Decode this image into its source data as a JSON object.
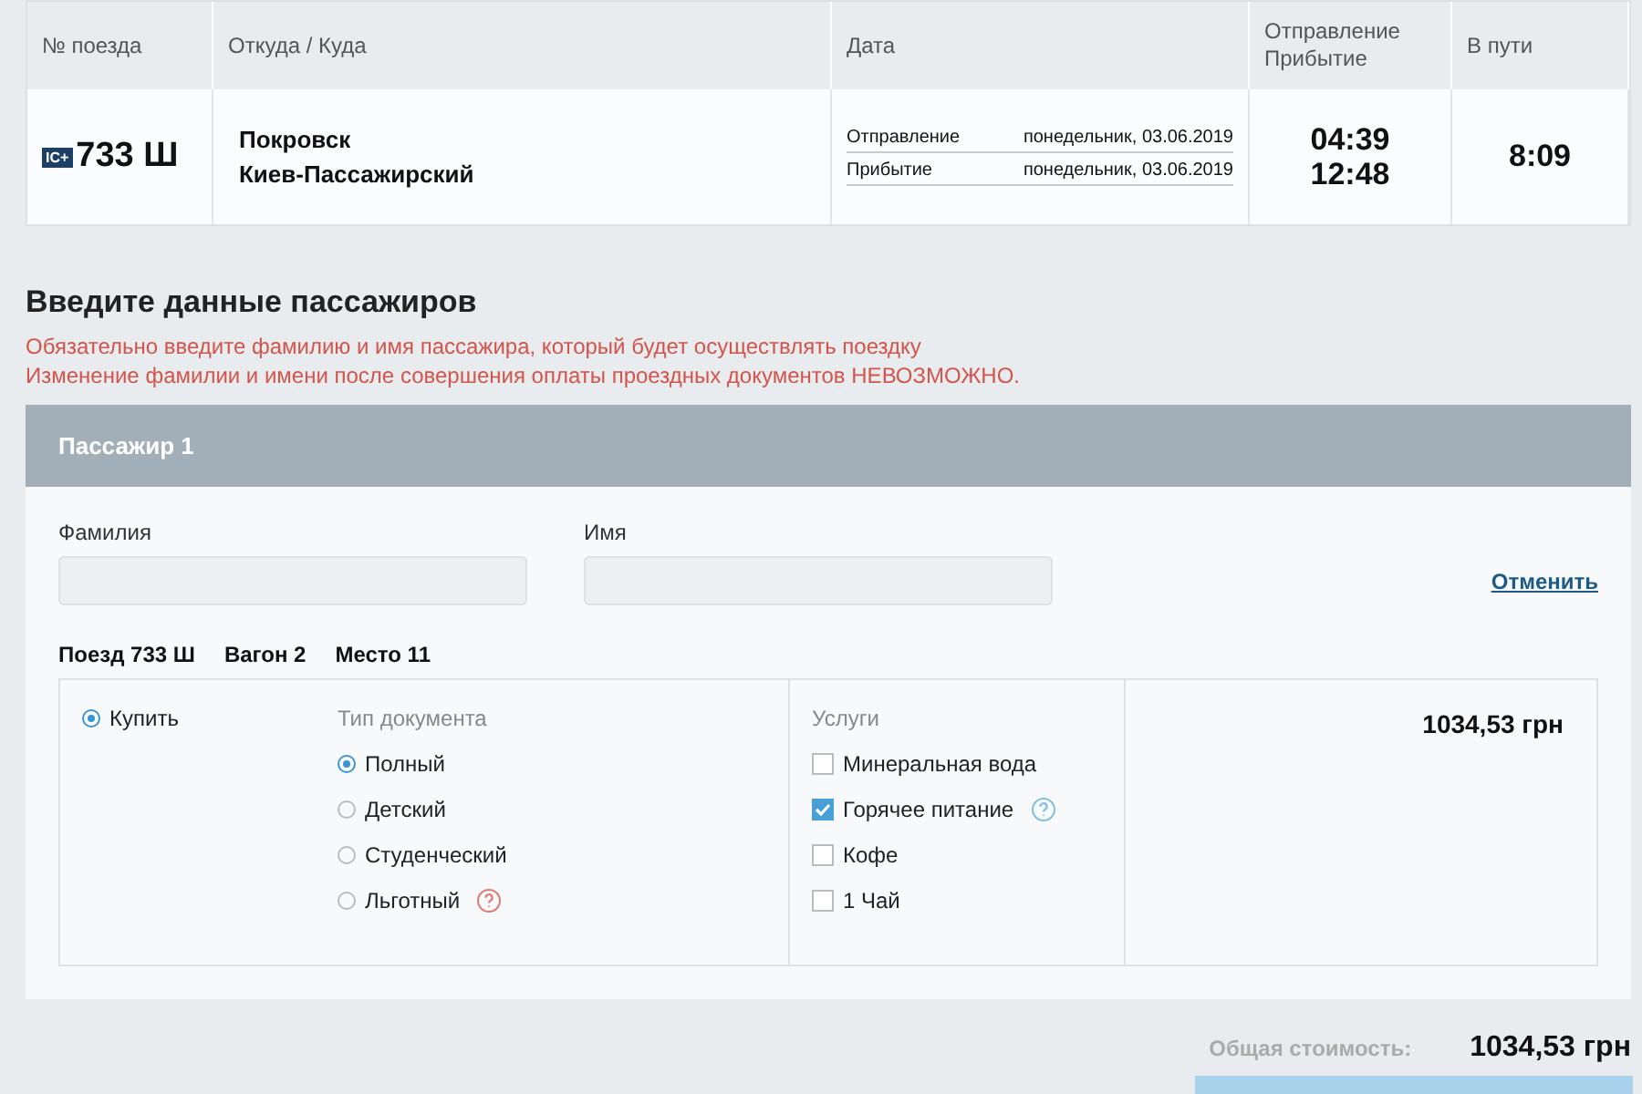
{
  "trip_table": {
    "columns": [
      "№ поезда",
      "Откуда / Куда",
      "Дата",
      "Отправление Прибытие",
      "В пути"
    ],
    "row": {
      "train_badge": "IC+",
      "train": "733 Ш",
      "from": "Покровск",
      "to": "Киев-Пассажирский",
      "dates": [
        {
          "label": "Отправление",
          "value": "понедельник, 03.06.2019"
        },
        {
          "label": "Прибытие",
          "value": "понедельник, 03.06.2019"
        }
      ],
      "departure": "04:39",
      "arrival": "12:48",
      "duration": "8:09"
    }
  },
  "section_title": "Введите данные пассажиров",
  "warnings": [
    "Обязательно введите фамилию и имя пассажира, который будет осуществлять поездку",
    "Изменение фамилии и имени после совершения оплаты проездных документов НЕВОЗМОЖНО."
  ],
  "passenger": {
    "title": "Пассажир 1",
    "fields": [
      {
        "label": "Фамилия"
      },
      {
        "label": "Имя"
      }
    ],
    "cancel_link": "Отменить",
    "seat_info": [
      "Поезд 733 Ш",
      "Вагон 2",
      "Место 11"
    ],
    "buy": {
      "label": "Купить",
      "selected": true
    },
    "document_type": {
      "title": "Тип документа",
      "options": [
        {
          "label": "Полный",
          "selected": true,
          "help": false
        },
        {
          "label": "Детский",
          "selected": false,
          "help": false
        },
        {
          "label": "Студенческий",
          "selected": false,
          "help": false
        },
        {
          "label": "Льготный",
          "selected": false,
          "help": true
        }
      ]
    },
    "services": {
      "title": "Услуги",
      "items": [
        {
          "label": "Минеральная вода",
          "checked": false,
          "help": false
        },
        {
          "label": "Горячее питание",
          "checked": true,
          "help": true
        },
        {
          "label": "Кофе",
          "checked": false,
          "help": false
        },
        {
          "label": "1 Чай",
          "checked": false,
          "help": false
        }
      ]
    },
    "price": "1034,53 грн"
  },
  "total": {
    "label": "Общая стоимость:",
    "value": "1034,53 грн"
  }
}
